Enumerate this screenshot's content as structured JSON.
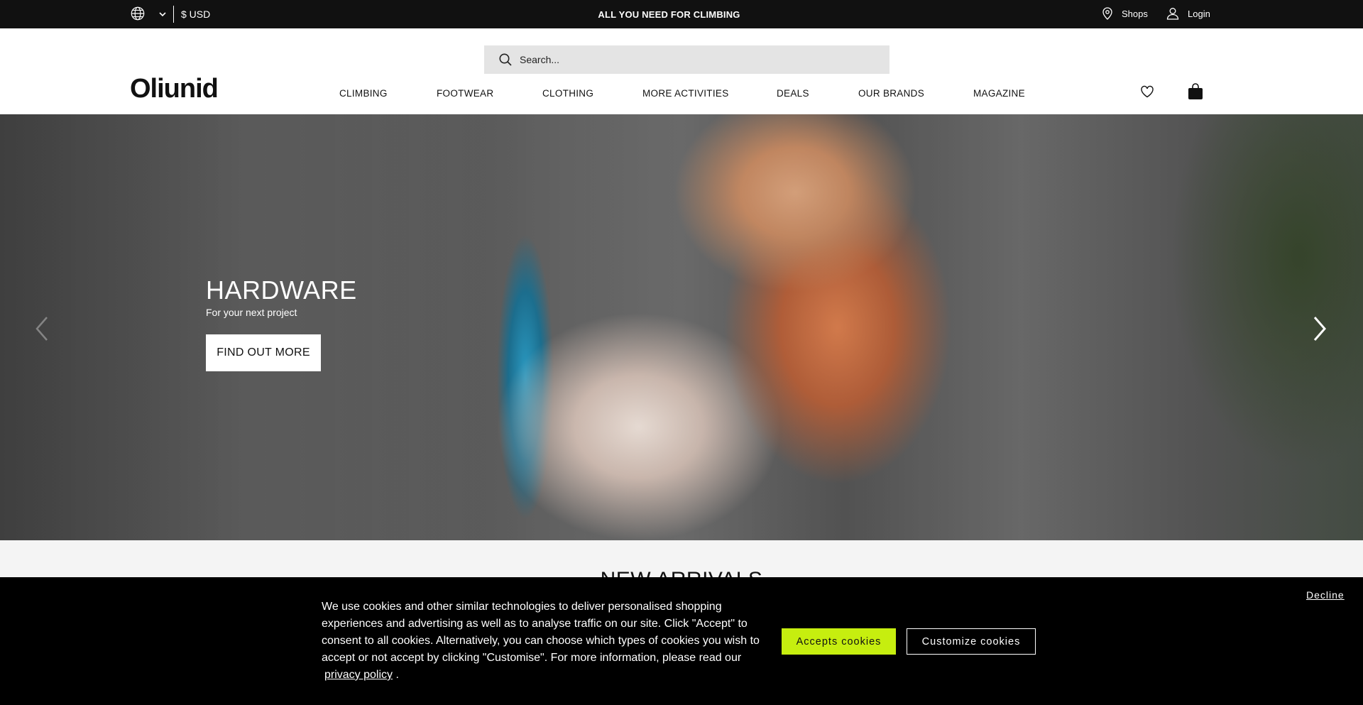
{
  "topbar": {
    "currency": "$  USD",
    "promo": "ALL YOU NEED FOR CLIMBING",
    "shops_label": "Shops",
    "login_label": "Login"
  },
  "header": {
    "search_placeholder": "Search...",
    "logo_text": "Oliunid",
    "nav": [
      "CLIMBING",
      "FOOTWEAR",
      "CLOTHING",
      "MORE ACTIVITIES",
      "DEALS",
      "OUR BRANDS",
      "MAGAZINE"
    ]
  },
  "hero": {
    "title": "HARDWARE",
    "subtitle": "For your next project",
    "cta": "FIND OUT MORE"
  },
  "section": {
    "title": "NEW ARRIVALS"
  },
  "cookie": {
    "text": "We use cookies and other similar technologies to deliver personalised shopping experiences and advertising as well as to analyse traffic on our site. Click \"Accept\" to consent to all cookies. Alternatively, you can choose which types of cookies you wish to accept or not accept by clicking \"Customise\". For more information, please read our",
    "link": "privacy policy",
    "end": ".",
    "accept": "Accepts cookies",
    "customize": "Customize cookies",
    "decline": "Decline"
  },
  "icons": {
    "language": "globe-icon",
    "dropdown": "chevron-down-icon",
    "shops": "map-pin-icon",
    "login": "user-icon",
    "search": "search-icon",
    "wishlist": "heart-icon",
    "cart": "shopping-bag-icon",
    "prev": "chevron-left-icon",
    "next": "chevron-right-icon"
  },
  "colors": {
    "topbar_bg": "#111111",
    "accept_button": "#c6ee0f",
    "cookie_bg": "#000000"
  }
}
